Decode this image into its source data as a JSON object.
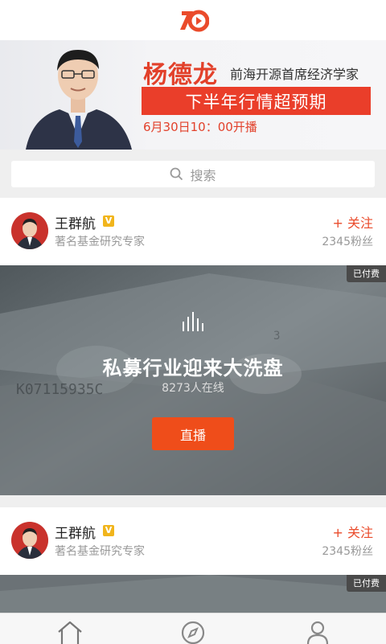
{
  "banner": {
    "name": "杨德龙",
    "subtitle": "前海开源首席经济学家",
    "ribbon": "下半年行情超预期",
    "date": "6月30日10：00开播"
  },
  "search": {
    "placeholder": "搜索"
  },
  "cards": [
    {
      "user_name": "王群航",
      "user_title": "著名基金研究专家",
      "follow_label": "+ 关注",
      "fans": "2345粉丝",
      "paid_badge": "已付费",
      "live_title": "私募行业迎来大洗盘",
      "online": "8273人在线",
      "live_button": "直播"
    },
    {
      "user_name": "王群航",
      "user_title": "著名基金研究专家",
      "follow_label": "+ 关注",
      "fans": "2345粉丝",
      "paid_badge": "已付费"
    }
  ],
  "verified_mark": "V",
  "tabbar": {
    "items": [
      "home-icon",
      "compass-icon",
      "user-icon"
    ]
  },
  "colors": {
    "accent": "#ea4b2b",
    "live_button": "#ef4d1a",
    "badge": "#f1b51c"
  }
}
